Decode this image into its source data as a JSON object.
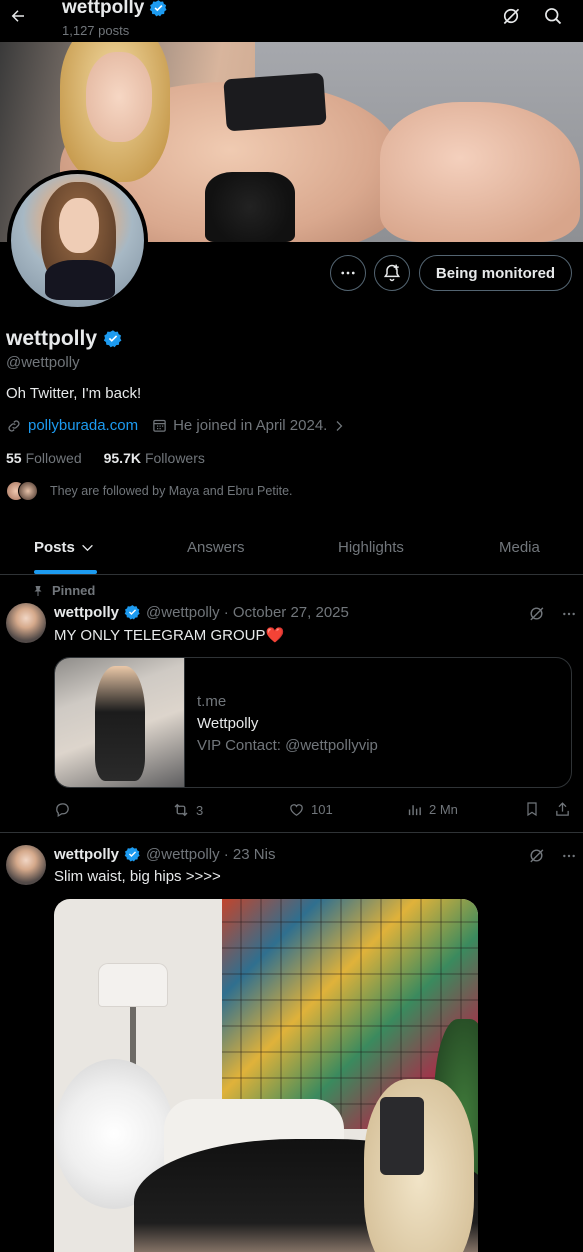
{
  "header": {
    "name": "wettpolly",
    "post_count": "1,127 posts"
  },
  "profile": {
    "display_name": "wettpolly",
    "handle": "@wettpolly",
    "bio": "Oh Twitter, I'm back!",
    "website": "pollyburada.com",
    "joined": "He joined in April 2024.",
    "following_count": "55",
    "following_label": "Followed",
    "followers_count": "95.7K",
    "followers_label": "Followers",
    "followed_by": "They are followed by Maya and Ebru Petite.",
    "monitor_button": "Being monitored"
  },
  "tabs": [
    {
      "label": "Posts",
      "active": true
    },
    {
      "label": "Answers",
      "active": false
    },
    {
      "label": "Highlights",
      "active": false
    },
    {
      "label": "Media",
      "active": false
    }
  ],
  "posts": [
    {
      "pinned_label": "Pinned",
      "name": "wettpolly",
      "handle_date": "@wettpolly · October 27, 2025",
      "text": "MY ONLY TELEGRAM GROUP❤️",
      "card": {
        "domain": "t.me",
        "title": "Wettpolly",
        "description": "VIP Contact: @wettpollyvip"
      },
      "reposts": "3",
      "likes": "101",
      "views": "2 Mn"
    },
    {
      "name": "wettpolly",
      "handle_date": "@wettpolly · 23 Nis",
      "text": "Slim waist, big hips >>>>"
    }
  ],
  "colors": {
    "accent": "#1d9bf0",
    "background": "#000000",
    "text": "#e7e9ea",
    "muted": "#71767b",
    "border": "#2f3336",
    "heart": "#f91880"
  },
  "icons": [
    "back-arrow-icon",
    "verified-badge-icon",
    "grok-icon",
    "search-icon",
    "more-icon",
    "notification-add-icon",
    "link-icon",
    "calendar-icon",
    "chevron-right-icon",
    "pin-icon",
    "reply-icon",
    "repost-icon",
    "like-icon",
    "views-icon",
    "bookmark-icon",
    "share-icon"
  ]
}
